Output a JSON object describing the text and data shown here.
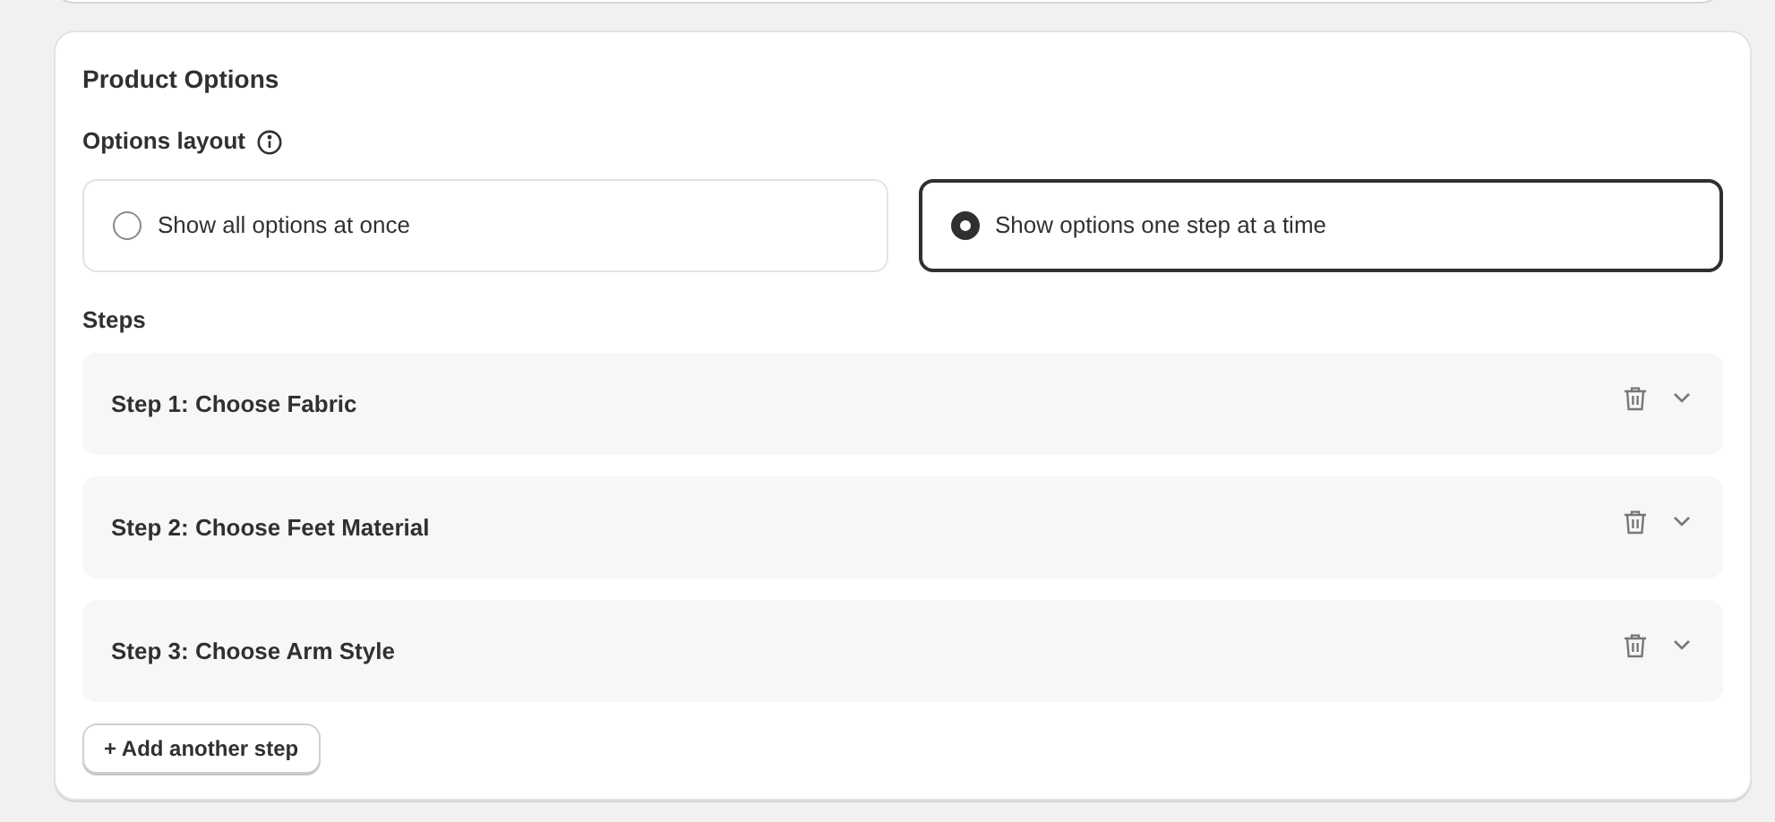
{
  "card": {
    "title": "Product Options"
  },
  "options_layout": {
    "label": "Options layout",
    "choices": [
      {
        "label": "Show all options at once",
        "selected": false
      },
      {
        "label": "Show options one step at a time",
        "selected": true
      }
    ]
  },
  "steps": {
    "label": "Steps",
    "items": [
      {
        "title": "Step 1: Choose Fabric",
        "expanded": false
      },
      {
        "title": "Step 2: Choose Feet Material",
        "expanded": false
      },
      {
        "title": "Step 3: Choose Arm Style",
        "expanded": false
      }
    ]
  },
  "add_button": "+ Add another step"
}
